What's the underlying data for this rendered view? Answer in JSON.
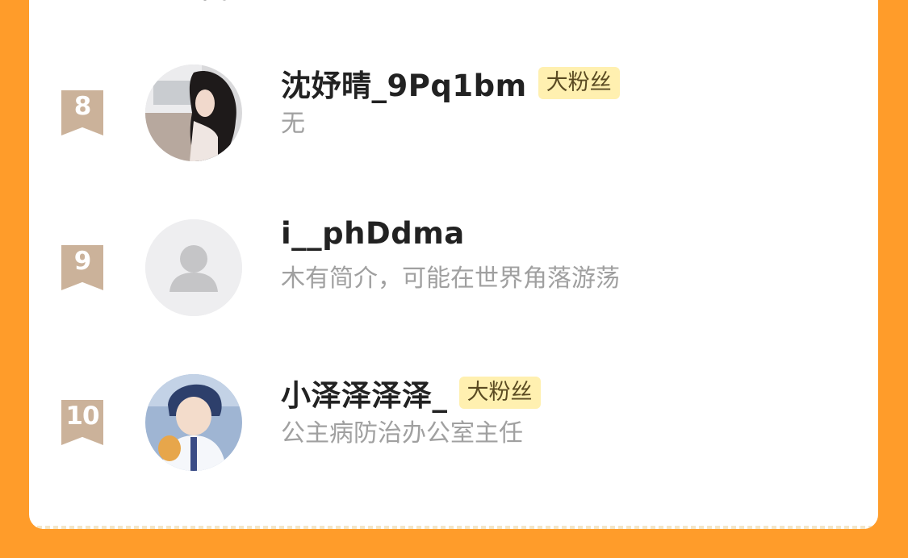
{
  "ranking": {
    "rows": [
      {
        "rank": "8",
        "username": "沈妤晴_9Pq1bm",
        "badge": "大粉丝",
        "bio": "无",
        "avatar": "avatar-photo-girl"
      },
      {
        "rank": "9",
        "username": "i__phDdma",
        "badge": "",
        "bio": "木有简介，可能在世界角落游荡",
        "avatar": "default-user-icon"
      },
      {
        "rank": "10",
        "username": "小泽泽泽泽_",
        "badge": "大粉丝",
        "bio": "公主病防治办公室主任",
        "avatar": "avatar-anime-boy"
      }
    ]
  },
  "colors": {
    "background": "#FF9C2A",
    "card": "#FFFFFF",
    "rank_badge": "#CBB29A",
    "fan_badge_bg": "#FFF0B0",
    "username": "#222222",
    "bio": "#A0A0A0"
  }
}
